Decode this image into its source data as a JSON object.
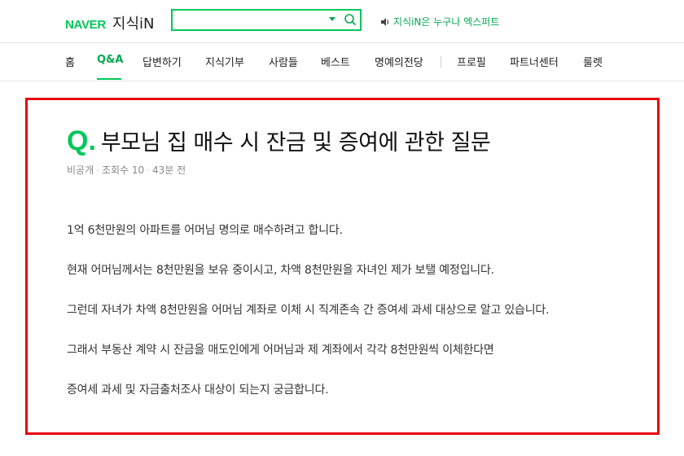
{
  "header": {
    "logo_brand": "NAVER",
    "logo_service": "지식iN",
    "search": {
      "value": "",
      "placeholder": ""
    },
    "notice": "지식iN은 누구나 엑스퍼트"
  },
  "nav": {
    "items": [
      {
        "label": "홈"
      },
      {
        "label": "Q&A"
      },
      {
        "label": "답변하기"
      },
      {
        "label": "지식기부"
      },
      {
        "label": "사람들"
      },
      {
        "label": "베스트"
      },
      {
        "label": "명예의전당"
      },
      {
        "label": "프로필"
      },
      {
        "label": "파트너센터"
      },
      {
        "label": "룰렛"
      }
    ],
    "active": "Q&A"
  },
  "question": {
    "mark": "Q.",
    "title": "부모님 집 매수 시 잔금 및 증여에 관한 질문",
    "meta": {
      "author": "비공개",
      "views": "조회수 10",
      "time": "43분 전"
    },
    "paragraphs": [
      "1억 6천만원의 아파트를 어머님 명의로 매수하려고 합니다.",
      "현재 어머님께서는 8천만원을 보유 중이시고, 차액 8천만원을 자녀인 제가 보탤 예정입니다.",
      "그런데 자녀가 차액 8천만원을 어머님 계좌로 이체 시 직계존속 간 증여세 과세 대상으로 알고 있습니다.",
      "그래서 부동산 계약 시 잔금을 매도인에게 어머님과 제 계좌에서 각각 8천만원씩 이체한다면",
      "증여세 과세 및 자금출처조사 대상이 되는지 궁금합니다."
    ]
  },
  "colors": {
    "brand_green": "#03c75a",
    "highlight_border": "#e60012"
  }
}
